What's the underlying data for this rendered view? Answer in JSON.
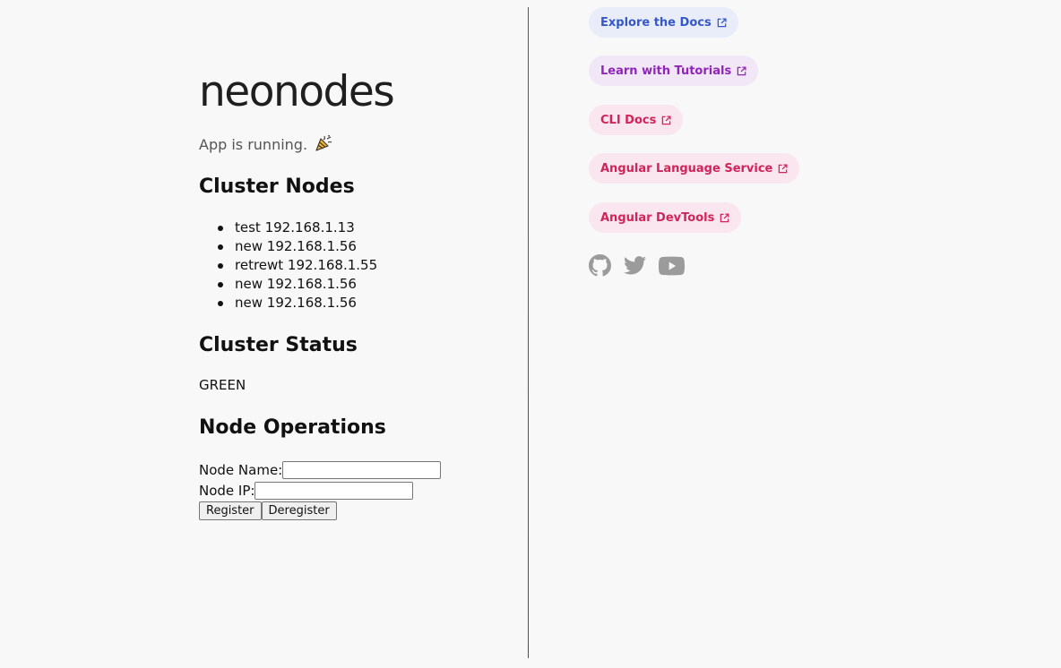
{
  "app": {
    "title": "neonodes",
    "status_text": "App is running."
  },
  "cluster_nodes": {
    "heading": "Cluster Nodes",
    "nodes": [
      "test 192.168.1.13",
      "new 192.168.1.56",
      "retrewt 192.168.1.55",
      "new 192.168.1.56",
      "new 192.168.1.56"
    ]
  },
  "cluster_status": {
    "heading": "Cluster Status",
    "value": "GREEN"
  },
  "node_operations": {
    "heading": "Node Operations",
    "name_label": "Node Name:",
    "name_value": "",
    "ip_label": "Node IP:",
    "ip_value": "",
    "register_label": "Register",
    "deregister_label": "Deregister"
  },
  "links": [
    {
      "label": "Explore the Docs",
      "color": "#3457c9",
      "bg": "#e9edfa"
    },
    {
      "label": "Learn with Tutorials",
      "color": "#9125ba",
      "bg": "#f1e7f7"
    },
    {
      "label": "CLI Docs",
      "color": "#d1245a",
      "bg": "#fae6ee"
    },
    {
      "label": "Angular Language Service",
      "color": "#d1245a",
      "bg": "#fae6ee"
    },
    {
      "label": "Angular DevTools",
      "color": "#d1245a",
      "bg": "#fae6ee"
    }
  ],
  "social_icons": [
    "github-icon",
    "twitter-icon",
    "youtube-icon"
  ],
  "colors": {
    "divider_top": "#dd1c3b",
    "divider_bottom": "#8a18c8",
    "social_icon": "#9b9b9b"
  }
}
